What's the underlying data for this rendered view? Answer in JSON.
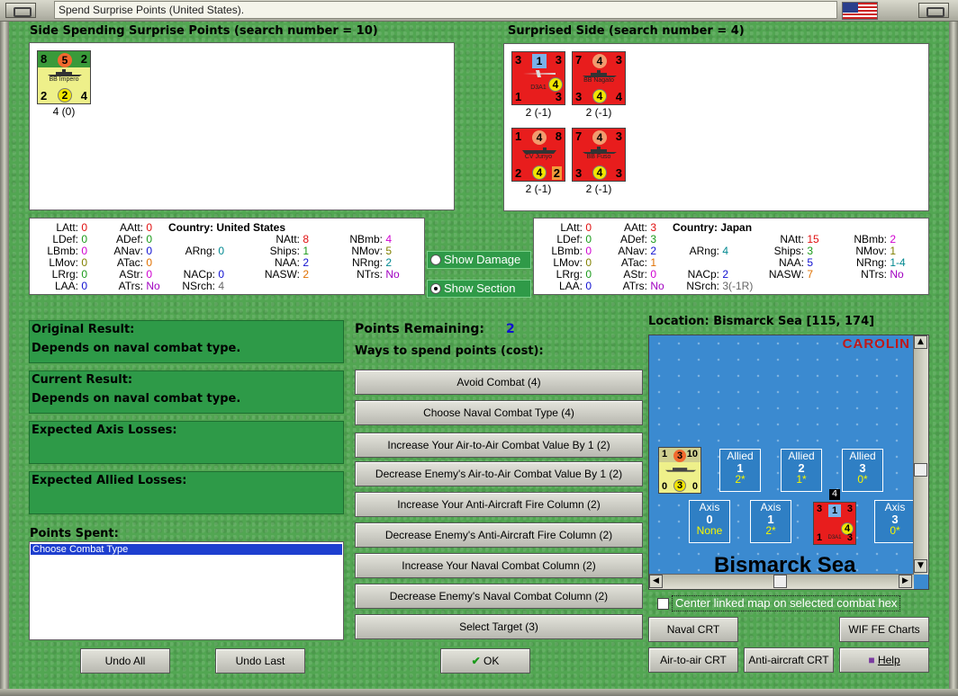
{
  "window": {
    "title": "Spend Surprise Points (United States)."
  },
  "spending_side": {
    "heading": "Side Spending Surprise Points (search number = 10)",
    "units": [
      {
        "tl": "8",
        "tc": "5",
        "tr": "2",
        "name": "BB Impero",
        "bl": "2",
        "bc": "2",
        "br": "4",
        "caption": "4 (0)"
      }
    ]
  },
  "surprised_side": {
    "heading": "Surprised Side (search number = 4)",
    "units": [
      {
        "tl": "3",
        "tc": "1",
        "tr": "3",
        "name": "D3A1",
        "bl": "1",
        "bc": "4",
        "br": "3",
        "caption": "2 (-1)"
      },
      {
        "tl": "7",
        "tc": "4",
        "tr": "3",
        "name": "BB Nagato",
        "bl": "3",
        "bc": "4",
        "br": "4",
        "caption": "2 (-1)"
      },
      {
        "tl": "1",
        "tc": "4",
        "tr": "8",
        "name": "CV Junyo",
        "bl": "2",
        "bc": "4",
        "br": "2",
        "caption": "2 (-1)"
      },
      {
        "tl": "7",
        "tc": "4",
        "tr": "3",
        "name": "BB Fuso",
        "bl": "3",
        "bc": "4",
        "br": "3",
        "caption": "2 (-1)"
      }
    ]
  },
  "stats_left": {
    "country_label": "Country:",
    "country": "United States",
    "latt": "0",
    "ldef": "0",
    "lbmb": "0",
    "lmov": "0",
    "lrrg": "0",
    "laa": "0",
    "aatt": "0",
    "adef": "0",
    "anav": "0",
    "atac": "0",
    "astr": "0",
    "atrs": "No",
    "arng": "0",
    "nacp": "0",
    "nsrch": "4",
    "natt": "8",
    "ships": "1",
    "naa": "2",
    "nasw": "2",
    "nbmb": "4",
    "nmov": "5",
    "nrng": "2",
    "ntrs": "No"
  },
  "stats_right": {
    "country_label": "Country:",
    "country": "Japan",
    "latt": "0",
    "ldef": "0",
    "lbmb": "0",
    "lmov": "0",
    "lrrg": "0",
    "laa": "0",
    "aatt": "3",
    "adef": "3",
    "anav": "2",
    "atac": "1",
    "astr": "0",
    "atrs": "No",
    "arng": "4",
    "nacp": "2",
    "nsrch": "3(-1R)",
    "natt": "15",
    "ships": "3",
    "naa": "5",
    "nasw": "7",
    "nbmb": "2",
    "nmov": "1",
    "nrng": "1-4",
    "ntrs": "No"
  },
  "stat_keys": {
    "latt": "LAtt:",
    "ldef": "LDef:",
    "lbmb": "LBmb:",
    "lmov": "LMov:",
    "lrrg": "LRrg:",
    "laa": "LAA:",
    "aatt": "AAtt:",
    "adef": "ADef:",
    "anav": "ANav:",
    "atac": "ATac:",
    "astr": "AStr:",
    "atrs": "ATrs:",
    "arng": "ARng:",
    "nacp": "NACp:",
    "nsrch": "NSrch:",
    "natt": "NAtt:",
    "ships": "Ships:",
    "naa": "NAA:",
    "nasw": "NASW:",
    "nbmb": "NBmb:",
    "nmov": "NMov:",
    "nrng": "NRng:",
    "ntrs": "NTrs:"
  },
  "toggles": {
    "show_damage": "Show Damage",
    "show_section": "Show Section"
  },
  "results": {
    "original_label": "Original Result:",
    "original_value": "Depends on naval combat type.",
    "current_label": "Current Result:",
    "current_value": "Depends on naval combat type.",
    "axis_losses_label": "Expected Axis Losses:",
    "allied_losses_label": "Expected Allied Losses:"
  },
  "points": {
    "remaining_label": "Points Remaining:",
    "remaining_value": "2",
    "ways_label": "Ways to spend points (cost):",
    "options": [
      "Avoid Combat (4)",
      "Choose Naval Combat Type (4)",
      "Increase Your Air-to-Air Combat Value By 1 (2)",
      "Decrease Enemy's Air-to-Air Combat Value By 1 (2)",
      "Increase Your Anti-Aircraft Fire Column (2)",
      "Decrease Enemy's Anti-Aircraft Fire Column (2)",
      "Increase Your Naval Combat Column (2)",
      "Decrease Enemy's Naval Combat Column (2)",
      "Select Target (3)"
    ],
    "spent_label": "Points Spent:",
    "spent_items": [
      "Choose Combat Type"
    ]
  },
  "map": {
    "location": "Location: Bismarck Sea [115, 174]",
    "top_label": "CAROLIN",
    "sea_label": "Bismarck Sea",
    "allied_slots": [
      {
        "side": "Allied",
        "num": "1",
        "sub": "2*"
      },
      {
        "side": "Allied",
        "num": "2",
        "sub": "1*"
      },
      {
        "side": "Allied",
        "num": "3",
        "sub": "0*"
      }
    ],
    "axis_slots": [
      {
        "side": "Axis",
        "num": "0",
        "sub": "None"
      },
      {
        "side": "Axis",
        "num": "1",
        "sub": "2*"
      },
      {
        "side": "Axis",
        "num": "3",
        "sub": "0*"
      }
    ],
    "map_unit_allied": {
      "tl": "1",
      "tc": "3",
      "tr": "10",
      "bl": "0",
      "bc": "3",
      "br": "0"
    },
    "map_unit_axis": {
      "tl": "3",
      "tc": "1",
      "tr": "3",
      "bl": "1",
      "bc": "4",
      "br": "3",
      "name": "D3A1",
      "stack": "4"
    },
    "center_label": "Center linked map on selected combat hex"
  },
  "buttons": {
    "undo_all": "Undo All",
    "undo_last": "Undo Last",
    "ok": "OK",
    "naval_crt": "Naval CRT",
    "wif_charts": "WIF FE Charts",
    "air_crt": "Air-to-air CRT",
    "aa_crt": "Anti-aircraft CRT",
    "help": "Help"
  }
}
